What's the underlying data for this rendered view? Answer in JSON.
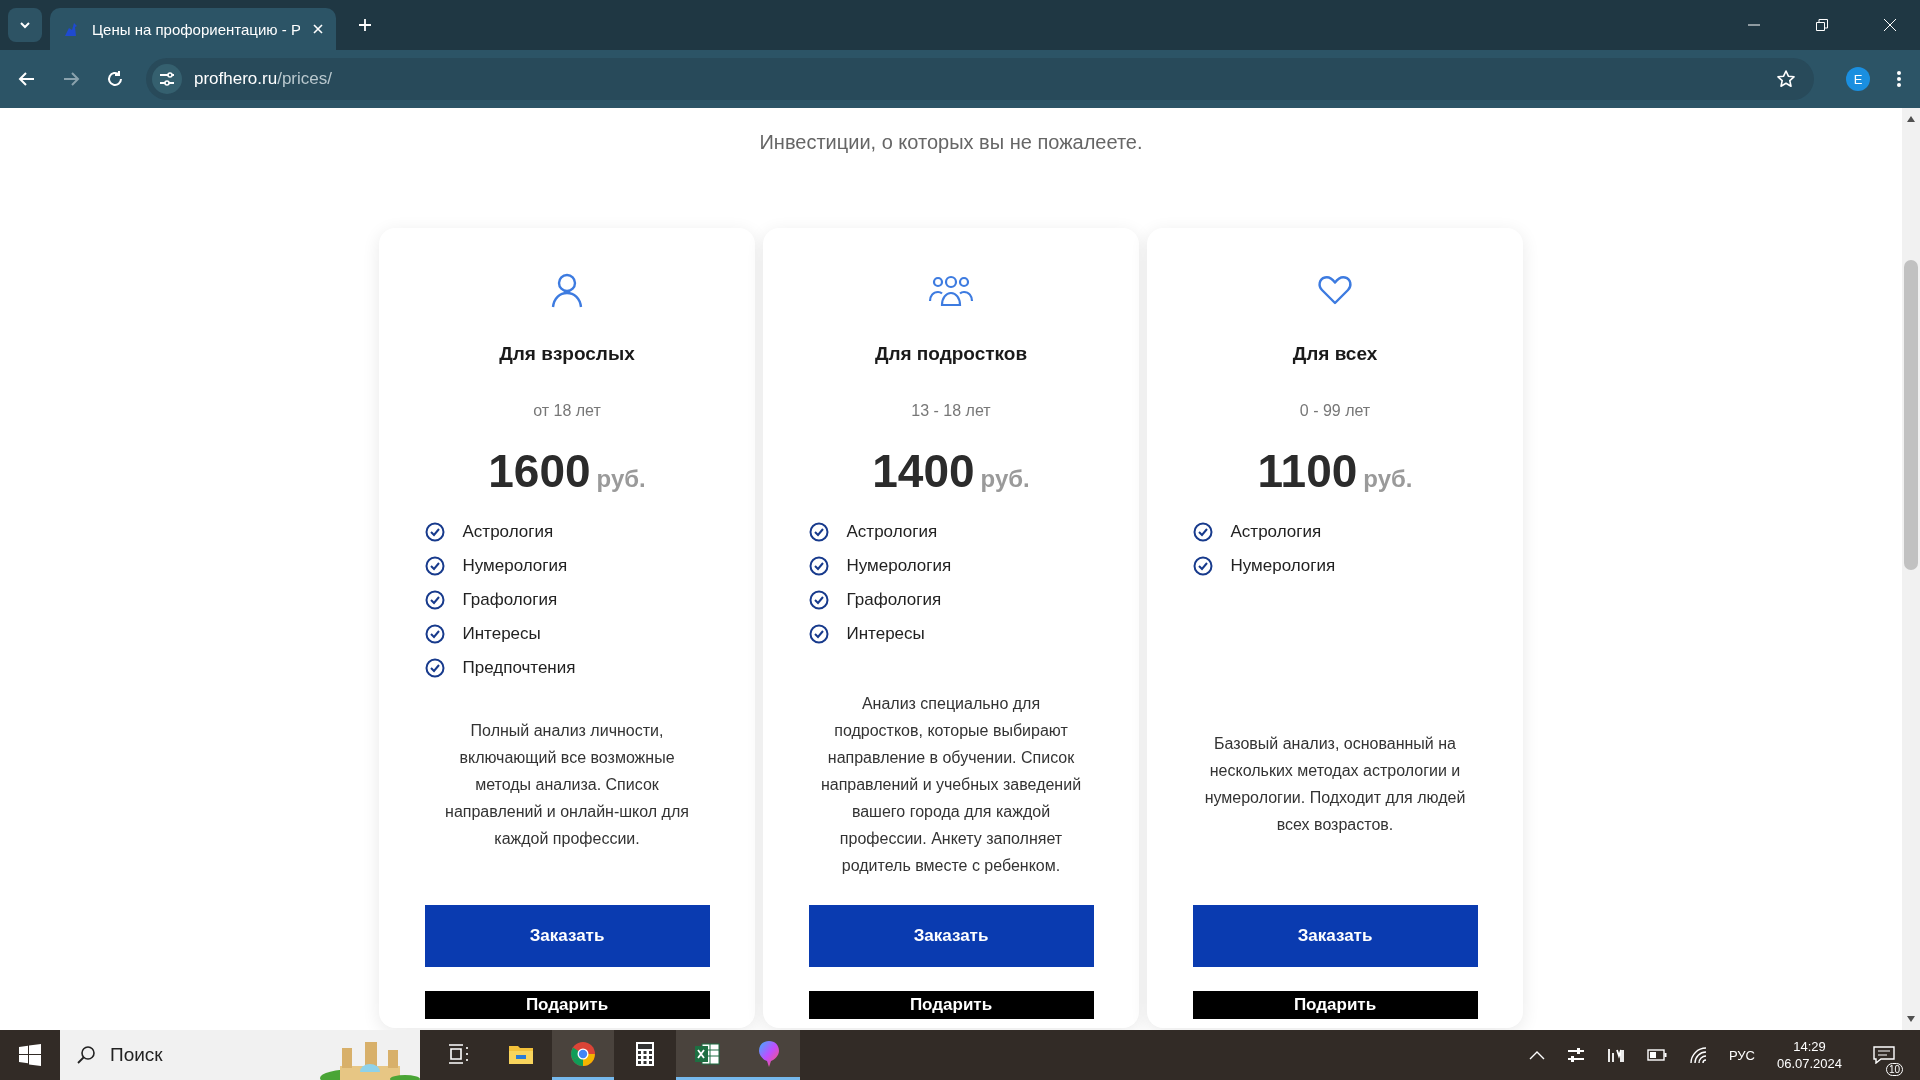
{
  "browser": {
    "tab": {
      "title": "Цены на профориентацию - Р",
      "selected": true
    },
    "url": {
      "host": "profhero.ru",
      "path": "/prices/"
    },
    "profile_initial": "E"
  },
  "page": {
    "subtitle": "Инвестиции, о которых вы не пожалеете.",
    "plans": [
      {
        "kind": "person",
        "title": "Для взрослых",
        "age": "от 18 лет",
        "price": "1600",
        "currency": "руб.",
        "features": [
          "Астрология",
          "Нумерология",
          "Графология",
          "Интересы",
          "Предпочтения"
        ],
        "description": "Полный анализ личности, включающий все возможные методы анализа. Список направлений и онлайн-школ для каждой профессии.",
        "buttons": [
          "Заказать",
          "Подарить"
        ]
      },
      {
        "kind": "group",
        "title": "Для подростков",
        "age": "13 - 18 лет",
        "price": "1400",
        "currency": "руб.",
        "features": [
          "Астрология",
          "Нумерология",
          "Графология",
          "Интересы"
        ],
        "description": "Анализ специально для подростков, которые выбирают направление в обучении. Список направлений и учебных заведений вашего города для каждой профессии. Анкету заполняет родитель вместе с ребенком.",
        "buttons": [
          "Заказать",
          "Подарить"
        ]
      },
      {
        "kind": "heart",
        "title": "Для всех",
        "age": "0 - 99 лет",
        "price": "1100",
        "currency": "руб.",
        "features": [
          "Астрология",
          "Нумерология"
        ],
        "description": "Базовый анализ, основанный на нескольких методах астрологии и нумерологии. Подходит для людей всех возрастов.",
        "buttons": [
          "Заказать",
          "Подарить"
        ]
      }
    ]
  },
  "taskbar": {
    "search": {
      "placeholder": "Поиск"
    },
    "apps": [
      {
        "kind": "taskview",
        "running": false
      },
      {
        "kind": "explorer",
        "running": false
      },
      {
        "kind": "chrome",
        "running": true
      },
      {
        "kind": "calculator",
        "running": false
      },
      {
        "kind": "excel",
        "running": true
      },
      {
        "kind": "paint",
        "running": true
      }
    ],
    "language": "РУС",
    "time": "14:29",
    "date": "06.07.2024",
    "notifications": "10"
  }
}
